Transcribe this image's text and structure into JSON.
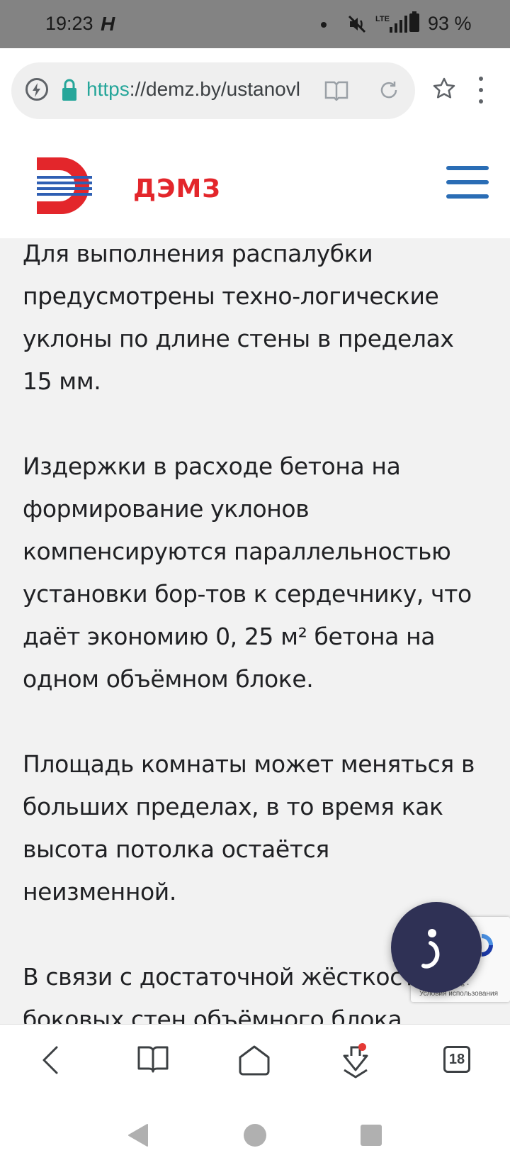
{
  "status_bar": {
    "time": "19:23",
    "h_icon": "H",
    "network": "LTE",
    "battery": "93 %"
  },
  "browser": {
    "url_scheme": "https",
    "url_rest": "://demz.by/ustanovl"
  },
  "site": {
    "logo_text": "ДЭМЗ",
    "brand_color": "#e3262b",
    "accent_color": "#2a6db5"
  },
  "content": {
    "paragraphs": [
      "Для выполнения распалубки предусмотрены техно-логические уклоны по длине стены в пределах 15 мм.",
      "Издержки в расходе бетона на формирование уклонов компенсируются параллельностью установки бор-тов к сердечнику, что даёт экономию 0, 25 м² бетона на одном объёмном блоке.",
      "Площадь комнаты может меняться в больших пределах, в то время как высота потолка остаётся неизменной.",
      "В связи с достаточной жёсткостью боковых стен объёмного блока «Лежачий стакан», возможно"
    ]
  },
  "recaptcha": {
    "privacy": "диальность -",
    "terms": "Условия использования"
  },
  "toolbar": {
    "tabs_count": "18"
  }
}
